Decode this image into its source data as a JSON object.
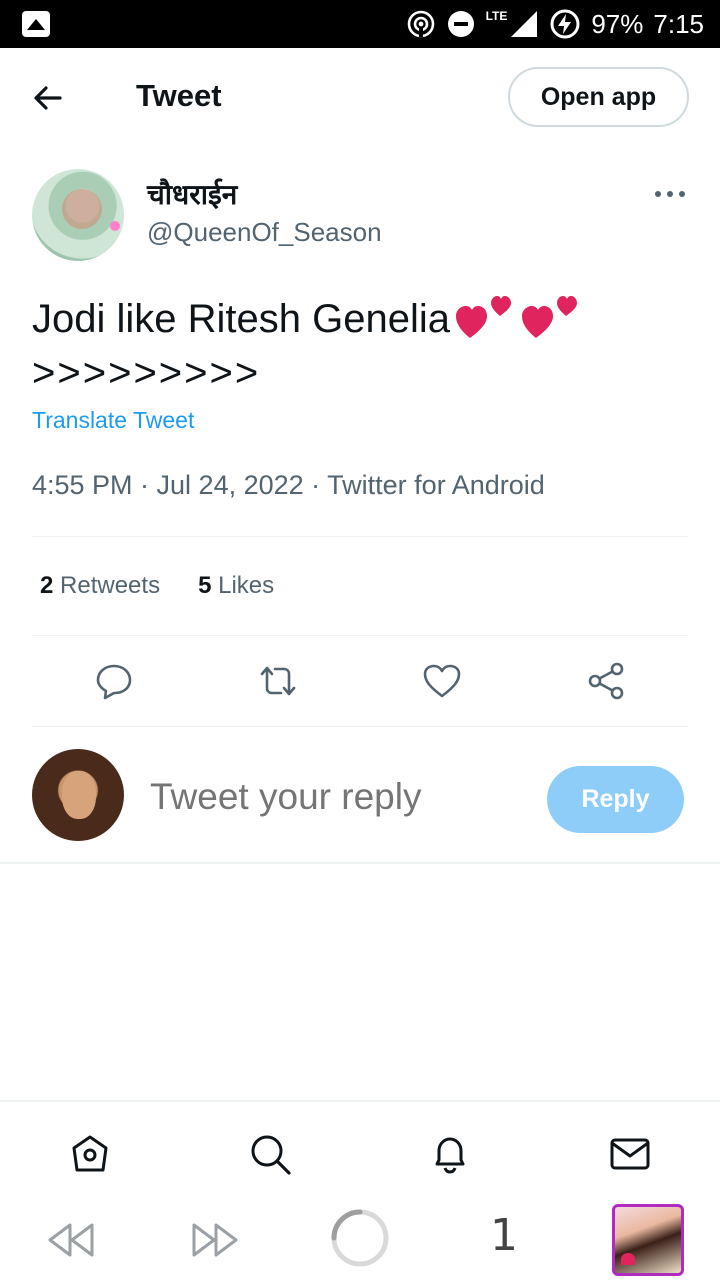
{
  "status_bar": {
    "network_type": "LTE",
    "battery": "97%",
    "time": "7:15"
  },
  "header": {
    "title": "Tweet",
    "open_app_label": "Open app"
  },
  "tweet": {
    "author_name": "चौधराईन",
    "author_handle": "@QueenOf_Season",
    "text_line1": "Jodi like Ritesh Genelia",
    "text_line2": ">>>>>>>>>",
    "emoji": "two-hearts",
    "translate_label": "Translate Tweet",
    "meta": "4:55 PM · Jul 24, 2022 · Twitter for Android",
    "retweets_count": "2",
    "retweets_label": "Retweets",
    "likes_count": "5",
    "likes_label": "Likes"
  },
  "reply": {
    "placeholder": "Tweet your reply",
    "button_label": "Reply"
  },
  "browser": {
    "tab_count": "1"
  },
  "colors": {
    "accent": "#1d9bf0",
    "reply_button": "#8ecdf8",
    "secondary_text": "#536471",
    "primary_text": "#0f1419",
    "heart": "#e0245e"
  }
}
